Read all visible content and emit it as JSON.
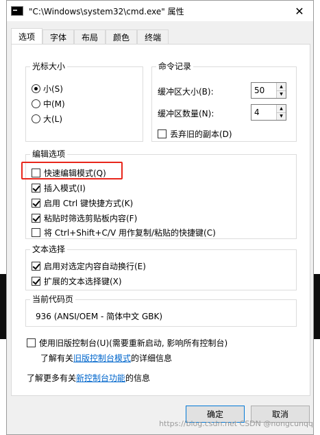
{
  "window": {
    "title": "\"C:\\Windows\\system32\\cmd.exe\" 属性",
    "close_glyph": "✕"
  },
  "tabs": [
    {
      "label": "选项",
      "active": true
    },
    {
      "label": "字体",
      "active": false
    },
    {
      "label": "布局",
      "active": false
    },
    {
      "label": "颜色",
      "active": false
    },
    {
      "label": "终端",
      "active": false
    }
  ],
  "cursor_size": {
    "title": "光标大小",
    "options": [
      {
        "label": "小(S)",
        "selected": true
      },
      {
        "label": "中(M)",
        "selected": false
      },
      {
        "label": "大(L)",
        "selected": false
      }
    ]
  },
  "command_history": {
    "title": "命令记录",
    "buffer_size_label": "缓冲区大小(B):",
    "buffer_size_value": "50",
    "buffer_count_label": "缓冲区数量(N):",
    "buffer_count_value": "4",
    "discard_old_label": "丢弃旧的副本(D)",
    "discard_old_checked": false
  },
  "edit_options": {
    "title": "编辑选项",
    "items": [
      {
        "label": "快速编辑模式(Q)",
        "checked": false
      },
      {
        "label": "插入模式(I)",
        "checked": true
      },
      {
        "label": "启用 Ctrl 键快捷方式(K)",
        "checked": true
      },
      {
        "label": "粘贴时筛选剪贴板内容(F)",
        "checked": true
      },
      {
        "label": "将 Ctrl+Shift+C/V 用作复制/粘贴的快捷键(C)",
        "checked": false
      }
    ]
  },
  "text_selection": {
    "title": "文本选择",
    "items": [
      {
        "label": "启用对选定内容自动换行(E)",
        "checked": true
      },
      {
        "label": "扩展的文本选择键(X)",
        "checked": true
      }
    ]
  },
  "codepage": {
    "title": "当前代码页",
    "value": "936   (ANSI/OEM - 简体中文 GBK)"
  },
  "legacy": {
    "checkbox_label": "使用旧版控制台(U)(需要重新启动, 影响所有控制台)",
    "checked": false,
    "learn_prefix": "了解有关",
    "learn_link": "旧版控制台模式",
    "learn_suffix": "的详细信息"
  },
  "new_features": {
    "prefix": "了解更多有关",
    "link": "新控制台功能",
    "suffix": "的信息"
  },
  "buttons": {
    "ok": "确定",
    "cancel": "取消"
  },
  "watermark": "https://blog.csdn.net CSDN @nongcunqq",
  "colors": {
    "highlight_box": "#e8251a",
    "link": "#0066cc",
    "primary_border": "#0078d7"
  }
}
